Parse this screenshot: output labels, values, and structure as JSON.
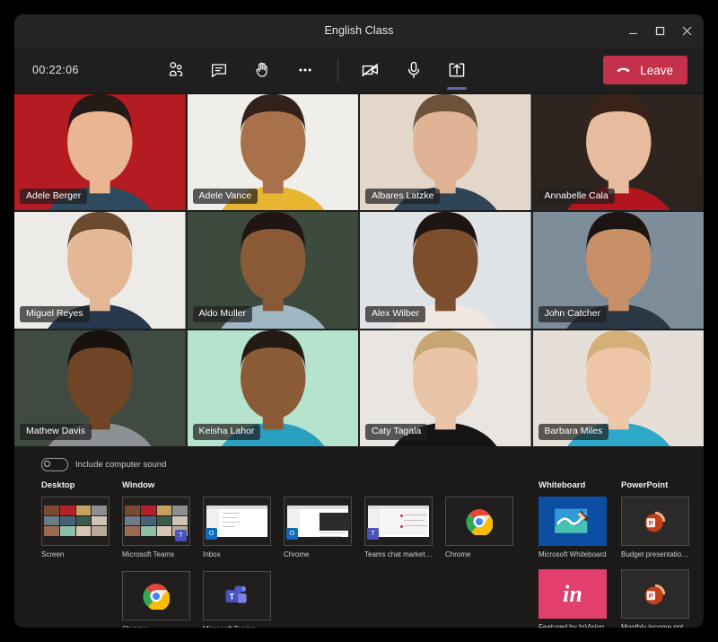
{
  "window": {
    "title": "English Class",
    "controls": {
      "minimize": "Minimize",
      "maximize": "Maximize",
      "close": "Close"
    }
  },
  "toolbar": {
    "timer": "00:22:06",
    "buttons": [
      {
        "name": "people-icon",
        "label": "Show participants"
      },
      {
        "name": "chat-icon",
        "label": "Show conversation"
      },
      {
        "name": "raise-hand-icon",
        "label": "Raise your hand"
      },
      {
        "name": "more-options-icon",
        "label": "More actions"
      }
    ],
    "media": [
      {
        "name": "camera-off-icon",
        "label": "Turn camera on",
        "state": "off"
      },
      {
        "name": "microphone-icon",
        "label": "Mute",
        "state": "on"
      },
      {
        "name": "share-screen-icon",
        "label": "Stop sharing",
        "state": "active"
      }
    ],
    "leave_label": "Leave",
    "accent_active": "#6264a7",
    "leave_color": "#c4314b"
  },
  "participants": [
    {
      "name": "Adele Berger",
      "bg": "#b51c22",
      "skin": "#e9b691",
      "hair": "#241a16",
      "top": "#2d4a5e"
    },
    {
      "name": "Adele Vance",
      "bg": "#efeeea",
      "skin": "#a9714a",
      "hair": "#32211a",
      "top": "#e8b530"
    },
    {
      "name": "Albares Latzke",
      "bg": "#e3d7cc",
      "skin": "#e0b394",
      "hair": "#6d5139",
      "top": "#2f4456"
    },
    {
      "name": "Annabelle Cala",
      "bg": "#2e2420",
      "skin": "#e6bb9e",
      "hair": "#3a2218",
      "top": "#b3151f"
    },
    {
      "name": "Miguel Reyes",
      "bg": "#ecebe7",
      "skin": "#e4b896",
      "hair": "#6b4a2f",
      "top": "#27384f"
    },
    {
      "name": "Aldo Muller",
      "bg": "#3d4a3e",
      "skin": "#8a5a37",
      "hair": "#201512",
      "top": "#9fb8c4"
    },
    {
      "name": "Alex Wilber",
      "bg": "#dfe3e6",
      "skin": "#7d4e2d",
      "hair": "#1d1512",
      "top": "#f0e7e0"
    },
    {
      "name": "John Catcher",
      "bg": "#7d8d99",
      "skin": "#c98f66",
      "hair": "#1c1411",
      "top": "#2b3744"
    },
    {
      "name": "Mathew Davis",
      "bg": "#3f4a42",
      "skin": "#6f4526",
      "hair": "#18110e",
      "top": "#8d9196"
    },
    {
      "name": "Keisha Lahor",
      "bg": "#b6e3cd",
      "skin": "#8b5a36",
      "hair": "#241a14",
      "top": "#2aa0c0"
    },
    {
      "name": "Caty Tagala",
      "bg": "#e9e6e2",
      "skin": "#eac4a6",
      "hair": "#c9a573",
      "top": "#141414"
    },
    {
      "name": "Barbara Miles",
      "bg": "#e6dfd8",
      "skin": "#edc6a8",
      "hair": "#d4b078",
      "top": "#2ea8c8"
    }
  ],
  "share_tray": {
    "computer_sound": {
      "label": "Include computer sound",
      "enabled": false
    },
    "sections": [
      {
        "heading": "Desktop",
        "items": [
          {
            "label": "Screen",
            "kind": "mini-grid",
            "badge": ""
          }
        ]
      },
      {
        "heading": "Window",
        "items": [
          {
            "label": "Microsoft Teams",
            "kind": "mini-grid",
            "badge": "teams"
          },
          {
            "label": "Inbox",
            "kind": "mini-win",
            "badge": "outlook"
          },
          {
            "label": "Chrome",
            "kind": "mini-win",
            "badge": "outlook"
          },
          {
            "label": "Teams chat marketing",
            "kind": "mini-win",
            "badge": "teams"
          },
          {
            "label": "Chrome",
            "kind": "app-chrome",
            "badge": ""
          },
          {
            "label": "Chrome",
            "kind": "app-chrome",
            "badge": ""
          },
          {
            "label": "Microsoft Teams",
            "kind": "app-teams",
            "badge": ""
          }
        ]
      },
      {
        "heading": "Whiteboard",
        "items": [
          {
            "label": "Microsoft Whiteboard",
            "kind": "tile-whiteboard",
            "badge": ""
          },
          {
            "label": "Featured by InVision",
            "kind": "tile-invision",
            "badge": "in"
          }
        ]
      },
      {
        "heading": "PowerPoint",
        "items": [
          {
            "label": "Budget presentation.ppt",
            "kind": "tile-ppt",
            "badge": ""
          },
          {
            "label": "Monthly income.ppt",
            "kind": "tile-ppt",
            "badge": ""
          }
        ]
      }
    ]
  }
}
